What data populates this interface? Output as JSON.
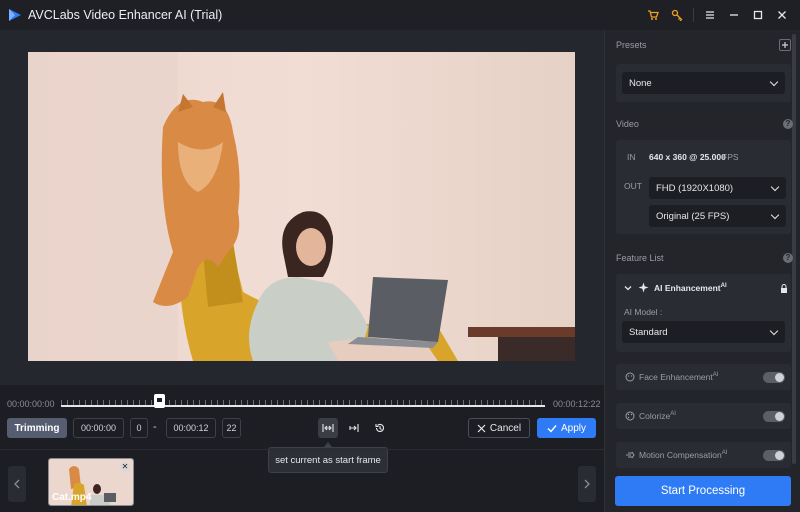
{
  "app": {
    "title": "AVCLabs Video Enhancer AI (Trial)"
  },
  "titlebar": {
    "icons": [
      "cart-icon",
      "key-icon",
      "menu-icon",
      "minimize-icon",
      "maximize-icon",
      "close-icon"
    ]
  },
  "timeline": {
    "start_time": "00:00:00:00",
    "end_time": "00:00:12:22",
    "position": 0.2
  },
  "controls": {
    "trimming_label": "Trimming",
    "start_time": "00:00:00",
    "start_frame": "0",
    "dash": "-",
    "end_time": "00:00:12",
    "end_frame": "22",
    "cancel_label": "Cancel",
    "apply_label": "Apply",
    "tooltip": "set current as start frame"
  },
  "filmstrip": {
    "files": [
      {
        "name": "Cat.mp4"
      }
    ]
  },
  "panel": {
    "presets_label": "Presets",
    "preset_value": "None",
    "video_label": "Video",
    "in_label": "IN",
    "in_resolution": "640 x 360 @ 25.000",
    "in_fps_unit": "FPS",
    "out_label": "OUT",
    "out_resolution": "FHD (1920X1080)",
    "out_fps": "Original (25 FPS)",
    "feature_list_label": "Feature List",
    "ai_enhancement_label": "AI Enhancement",
    "ai_sup": "AI",
    "ai_model_label": "AI Model :",
    "ai_model_value": "Standard",
    "features": [
      {
        "label": "Face Enhancement",
        "sup": "AI",
        "enabled": false
      },
      {
        "label": "Colorize",
        "sup": "AI",
        "enabled": false
      },
      {
        "label": "Motion Compensation",
        "sup": "AI",
        "enabled": false
      }
    ],
    "start_label": "Start Processing"
  },
  "colors": {
    "accent": "#2f7bf5",
    "bg": "#1c1e24",
    "panel": "#23252b"
  }
}
